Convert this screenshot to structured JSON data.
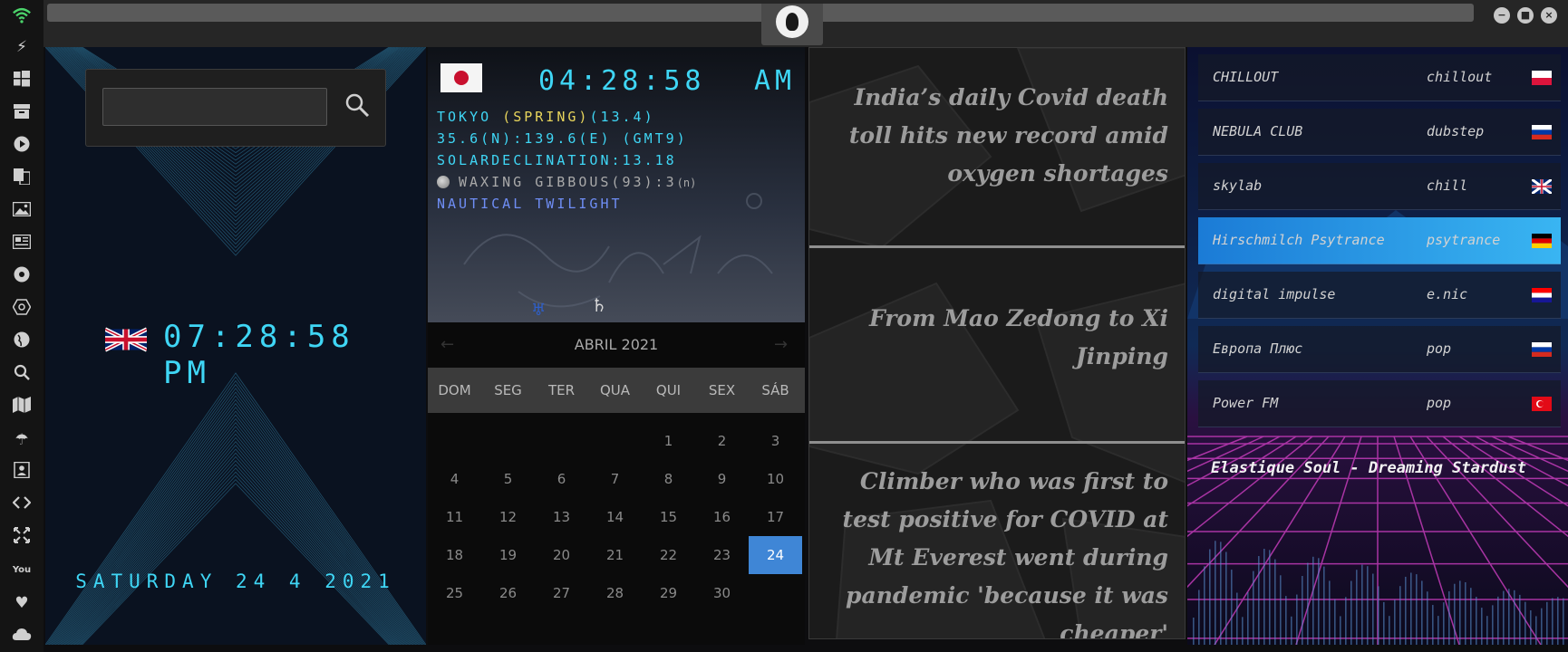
{
  "clock_panel": {
    "search_placeholder": "",
    "time": "07:28:58 PM",
    "date": "SATURDAY 24 4 2021"
  },
  "astro_panel": {
    "time": "04:28:58",
    "ampm": "AM",
    "line1_city": "TOKYO ",
    "line1_season": "(SPRING)",
    "line1_rest": "(13.4)",
    "coords": "35.6(N):139.6(E) (GMT9)",
    "declination": "SOLARDECLINATION:13.18",
    "moon": "WAXING GIBBOUS(93):3",
    "moon_suffix": "(n)",
    "twilight": "NAUTICAL TWILIGHT"
  },
  "calendar": {
    "title": "ABRIL 2021",
    "prev": "←",
    "next": "→",
    "weekdays": [
      "DOM",
      "SEG",
      "TER",
      "QUA",
      "QUI",
      "SEX",
      "SÁB"
    ],
    "days": [
      "1",
      "2",
      "3",
      "4",
      "5",
      "6",
      "7",
      "8",
      "9",
      "10",
      "11",
      "12",
      "13",
      "14",
      "15",
      "16",
      "17",
      "18",
      "19",
      "20",
      "21",
      "22",
      "23",
      "24",
      "25",
      "26",
      "27",
      "28",
      "29",
      "30"
    ],
    "selected_day": "24"
  },
  "news": {
    "items": [
      "India’s daily Covid death toll hits new record amid oxygen shortages",
      "From Mao Zedong to Xi Jinping",
      "Climber who was first to test positive for COVID at Mt Everest went during pandemic 'because it was cheaper'"
    ]
  },
  "radio": {
    "stations": [
      {
        "name": "CHILLOUT",
        "genre": "chillout",
        "flag": "pl"
      },
      {
        "name": "NEBULA CLUB",
        "genre": "dubstep",
        "flag": "ru"
      },
      {
        "name": "skylab",
        "genre": "chill",
        "flag": "gb"
      },
      {
        "name": "Hirschmilch Psytrance",
        "genre": "psytrance",
        "flag": "de"
      },
      {
        "name": "digital impulse",
        "genre": "e.nic",
        "flag": "hr"
      },
      {
        "name": "Европа Плюс",
        "genre": "pop",
        "flag": "ru"
      },
      {
        "name": "Power FM",
        "genre": "pop",
        "flag": "tr"
      }
    ],
    "active_index": 3,
    "now_playing": "Elastique Soul - Dreaming Stardust"
  },
  "sidebar_icons": [
    "wifi-icon",
    "bolt-icon",
    "windows-icon",
    "archive-icon",
    "play-icon",
    "translate-icon",
    "image-icon",
    "news-icon",
    "settings-icon",
    "hexagon-icon",
    "globe-icon",
    "search-icon",
    "map-icon",
    "umbrella-icon",
    "contact-icon",
    "code-icon",
    "fullscreen-icon",
    "youtube-icon",
    "heart-icon",
    "cloud-icon"
  ],
  "colors": {
    "accent": "#3fd6f5",
    "selected": "#3f86d6",
    "active_station": "#1b7bd6"
  }
}
